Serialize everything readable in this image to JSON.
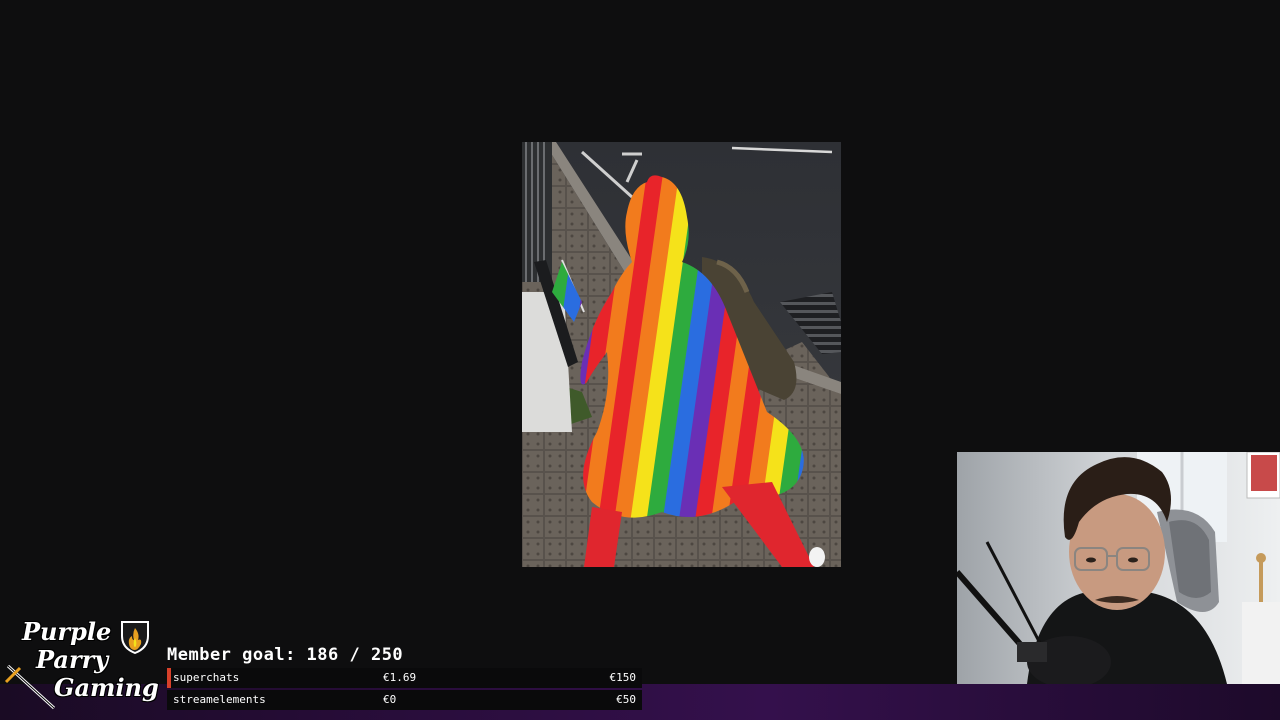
{
  "overlay": {
    "logo": {
      "line1": "Purple",
      "line2": "Parry",
      "line3": "Gaming",
      "shield_icon": "shield-flame-icon",
      "sword_icon": "crossed-swords-icon",
      "accent_color": "#e8a020"
    },
    "member_goal": {
      "label": "Member goal: 186 / 250",
      "current": 186,
      "target": 250
    },
    "goals": [
      {
        "name": "superchats",
        "current": "€1.69",
        "target": "€150",
        "accent_color": "#d8402a",
        "progress": 0.011
      },
      {
        "name": "streamelements",
        "current": "€0",
        "target": "€50",
        "accent_color": "#d8402a",
        "progress": 0
      }
    ],
    "colors": {
      "background": "#0e0e0f",
      "bottom_band": "#34104c"
    }
  }
}
